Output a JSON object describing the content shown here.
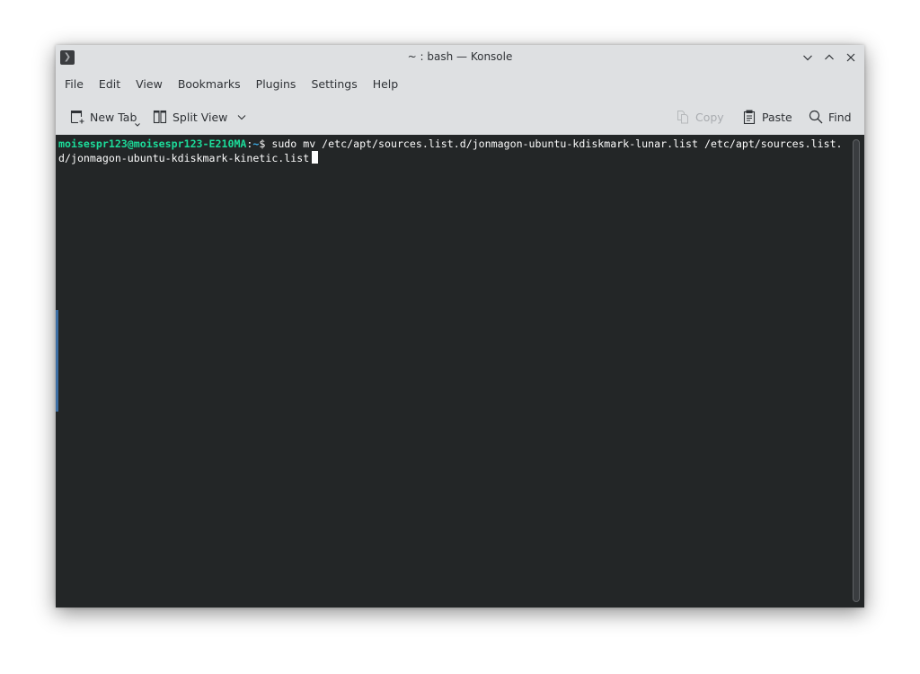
{
  "window": {
    "title": "~ : bash — Konsole",
    "app_icon": "terminal-icon",
    "controls": [
      {
        "name": "minimize",
        "icon": "chevron-down-icon"
      },
      {
        "name": "maximize",
        "icon": "chevron-up-icon"
      },
      {
        "name": "close",
        "icon": "close-icon"
      }
    ]
  },
  "menubar": {
    "items": [
      "File",
      "Edit",
      "View",
      "Bookmarks",
      "Plugins",
      "Settings",
      "Help"
    ]
  },
  "toolbar": {
    "new_tab_label": "New Tab",
    "new_tab_icon": "new-tab-icon",
    "split_view_label": "Split View",
    "split_view_icon": "split-view-icon",
    "copy_label": "Copy",
    "copy_icon": "copy-icon",
    "copy_enabled": false,
    "paste_label": "Paste",
    "paste_icon": "paste-icon",
    "find_label": "Find",
    "find_icon": "search-icon"
  },
  "terminal": {
    "prompt_user_host": "moisespr123@moisespr123-E210MA",
    "prompt_colon": ":",
    "prompt_path": "~",
    "prompt_symbol": "$ ",
    "command": "sudo mv /etc/apt/sources.list.d/jonmagon-ubuntu-kdiskmark-lunar.list /etc/apt/sources.list.d/jonmagon-ubuntu-kdiskmark-kinetic.list",
    "colors": {
      "background": "#232627",
      "foreground": "#fcfcfc",
      "user_host": "#1cdc9a",
      "path": "#3daee9"
    }
  }
}
